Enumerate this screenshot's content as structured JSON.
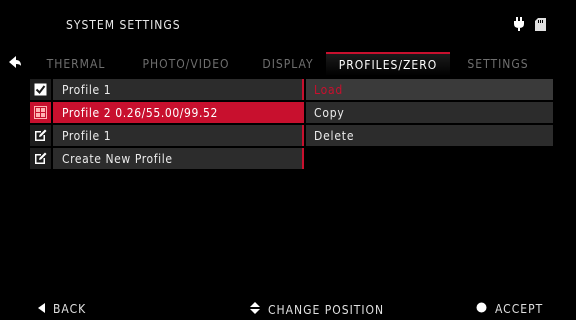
{
  "header": {
    "title": "SYSTEM SETTINGS",
    "icons": [
      "plug-icon",
      "sd-card-icon"
    ]
  },
  "tabs": [
    {
      "label": "THERMAL"
    },
    {
      "label": "PHOTO/VIDEO"
    },
    {
      "label": "DISPLAY"
    },
    {
      "label": "PROFILES/ZERO",
      "active": true
    },
    {
      "label": "SETTINGS"
    }
  ],
  "profiles": [
    {
      "label": "Profile 1",
      "icon": "checkbox-checked-icon"
    },
    {
      "label": "Profile 2 0.26/55.00/99.52",
      "icon": "grid-icon",
      "selected": true
    },
    {
      "label": "Profile 1",
      "icon": "edit-icon"
    },
    {
      "label": "Create New Profile",
      "icon": "edit-icon"
    }
  ],
  "actions": [
    {
      "label": "Load",
      "highlight": true
    },
    {
      "label": "Copy"
    },
    {
      "label": "Delete"
    }
  ],
  "footer": {
    "back": "BACK",
    "change": "CHANGE POSITION",
    "accept": "ACCEPT"
  },
  "colors": {
    "accent": "#c8102e",
    "row_bg": "#2c2c2c",
    "text": "#ececec"
  }
}
